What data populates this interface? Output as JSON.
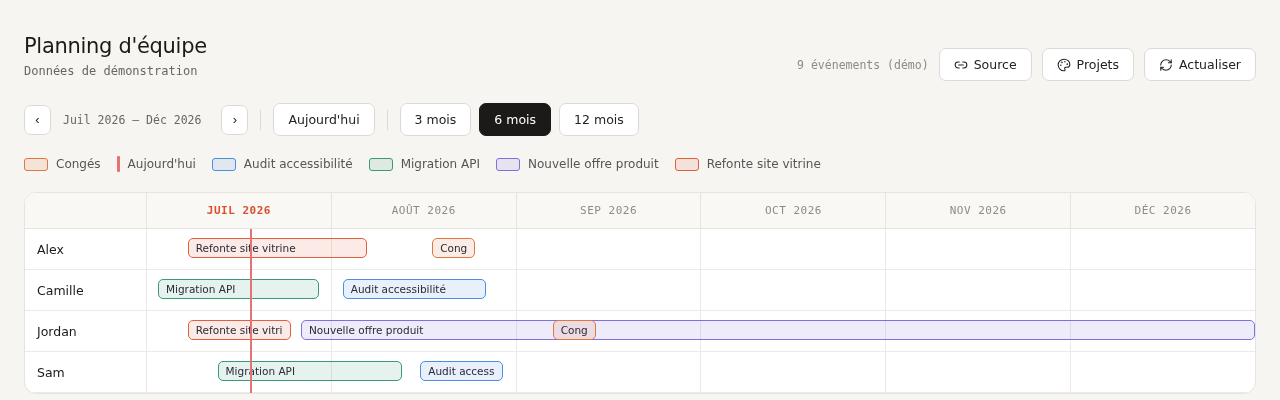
{
  "header": {
    "title": "Planning d'équipe",
    "subtitle": "Données de démonstration",
    "count": "9 événements (démo)",
    "buttons": [
      {
        "kind": "link",
        "label": "Source"
      },
      {
        "kind": "palette",
        "label": "Projets"
      },
      {
        "kind": "refresh",
        "label": "Actualiser"
      }
    ]
  },
  "toolbar": {
    "prev": "‹",
    "range": "Juil 2026 — Déc 2026",
    "next": "›",
    "today": "Aujourd'hui",
    "views": [
      {
        "label": "3 mois",
        "selected": false
      },
      {
        "label": "6 mois",
        "selected": true
      },
      {
        "label": "12 mois",
        "selected": false
      }
    ]
  },
  "legend": [
    {
      "kind": "swatch",
      "label": "Congés",
      "color": "#e2763f"
    },
    {
      "kind": "line",
      "label": "Aujourd'hui",
      "color": "#e57373"
    },
    {
      "kind": "swatch",
      "label": "Audit accessibilité",
      "color": "#4a8fe0"
    },
    {
      "kind": "swatch",
      "label": "Migration API",
      "color": "#3a9a78"
    },
    {
      "kind": "swatch",
      "label": "Nouvelle offre produit",
      "color": "#7d70e0"
    },
    {
      "kind": "swatch",
      "label": "Refonte site vitrine",
      "color": "#e0603e"
    }
  ],
  "timeline": {
    "months": [
      {
        "label": "JUIL 2026",
        "current": true
      },
      {
        "label": "AOÛT 2026",
        "current": false
      },
      {
        "label": "SEP 2026",
        "current": false
      },
      {
        "label": "OCT 2026",
        "current": false
      },
      {
        "label": "NOV 2026",
        "current": false
      },
      {
        "label": "DÉC 2026",
        "current": false
      }
    ],
    "people": [
      {
        "name": "Alex",
        "events": [
          {
            "label": "Refonte site vitrine",
            "color": "#e0603e"
          },
          {
            "label": "Cong",
            "color": "#e2763f"
          }
        ]
      },
      {
        "name": "Camille",
        "events": [
          {
            "label": "Migration API",
            "color": "#3a9a78"
          },
          {
            "label": "Audit accessibilité",
            "color": "#4a8fe0"
          }
        ]
      },
      {
        "name": "Jordan",
        "events": [
          {
            "label": "Refonte site vitri",
            "color": "#e0603e"
          },
          {
            "label": "Nouvelle offre produit",
            "color": "#7d70e0"
          },
          {
            "label": "Cong",
            "color": "#e2763f"
          }
        ]
      },
      {
        "name": "Sam",
        "events": [
          {
            "label": "Migration API",
            "color": "#3a9a78"
          },
          {
            "label": "Audit access",
            "color": "#4a8fe0"
          }
        ]
      }
    ]
  }
}
